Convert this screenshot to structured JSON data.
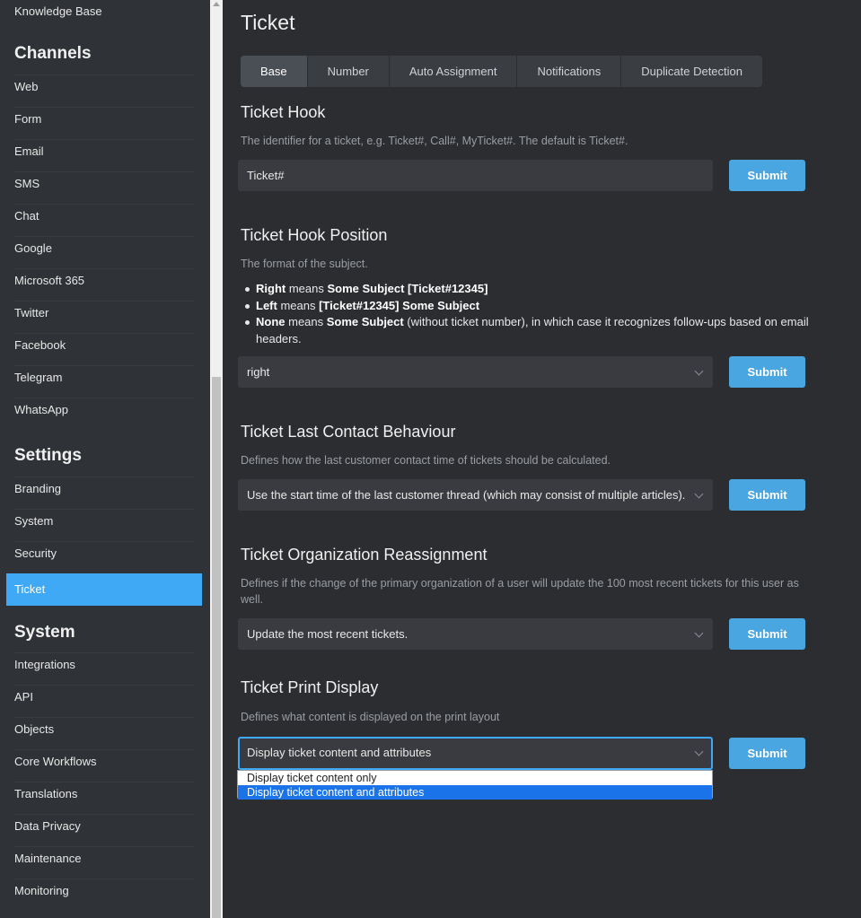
{
  "sidebar": {
    "top_item": "Knowledge Base",
    "channels_heading": "Channels",
    "channels": [
      "Web",
      "Form",
      "Email",
      "SMS",
      "Chat",
      "Google",
      "Microsoft 365",
      "Twitter",
      "Facebook",
      "Telegram",
      "WhatsApp"
    ],
    "settings_heading": "Settings",
    "settings": [
      "Branding",
      "System",
      "Security",
      "Ticket"
    ],
    "active_item": "Ticket",
    "system_heading": "System",
    "system": [
      "Integrations",
      "API",
      "Objects",
      "Core Workflows",
      "Translations",
      "Data Privacy",
      "Maintenance",
      "Monitoring"
    ]
  },
  "page": {
    "title": "Ticket"
  },
  "tabs": [
    "Base",
    "Number",
    "Auto Assignment",
    "Notifications",
    "Duplicate Detection"
  ],
  "active_tab": "Base",
  "submit_label": "Submit",
  "sections": {
    "hook": {
      "title": "Ticket Hook",
      "desc": "The identifier for a ticket, e.g. Ticket#, Call#, MyTicket#. The default is Ticket#.",
      "value": "Ticket#"
    },
    "hook_position": {
      "title": "Ticket Hook Position",
      "desc": "The format of the subject.",
      "bullets": [
        {
          "a": "Right",
          "b": " means ",
          "c": "Some Subject [Ticket#12345]",
          "d": ""
        },
        {
          "a": "Left",
          "b": " means ",
          "c": "[Ticket#12345] Some Subject",
          "d": ""
        },
        {
          "a": "None",
          "b": " means ",
          "c": "Some Subject",
          "d": " (without ticket number), in which case it recognizes follow-ups based on email headers."
        }
      ],
      "value": "right"
    },
    "last_contact": {
      "title": "Ticket Last Contact Behaviour",
      "desc": "Defines how the last customer contact time of tickets should be calculated.",
      "value": "Use the start time of the last customer thread (which may consist of multiple articles)."
    },
    "org_reassign": {
      "title": "Ticket Organization Reassignment",
      "desc": "Defines if the change of the primary organization of a user will update the 100 most recent tickets for this user as well.",
      "value": "Update the most recent tickets."
    },
    "print_display": {
      "title": "Ticket Print Display",
      "desc": "Defines what content is displayed on the print layout",
      "value": "Display ticket content and attributes",
      "options": [
        "Display ticket content only",
        "Display ticket content and attributes"
      ],
      "selected_option": "Display ticket content and attributes"
    }
  },
  "colors": {
    "accent": "#3fa9f5",
    "button": "#4aa6e0",
    "background": "#2b2d31",
    "sidebar": "#2f3236"
  },
  "icons": {
    "select": "chevron-down-icon"
  }
}
